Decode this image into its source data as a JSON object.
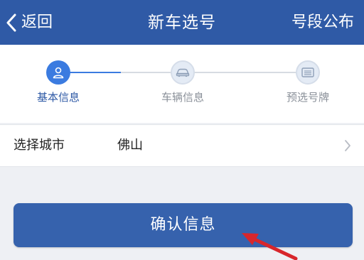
{
  "header": {
    "back_label": "返回",
    "title": "新车选号",
    "right_action": "号段公布",
    "background": "#2f5aa6"
  },
  "steps": {
    "items": [
      {
        "label": "基本信息",
        "icon": "user-icon",
        "active": true
      },
      {
        "label": "车辆信息",
        "icon": "car-icon",
        "active": false
      },
      {
        "label": "预选号牌",
        "icon": "license-plate-icon",
        "active": false
      }
    ],
    "active_color": "#3b7be0",
    "inactive_color": "#8a9099"
  },
  "city": {
    "label": "选择城市",
    "value": "佛山"
  },
  "confirm_button": {
    "label": "确认信息",
    "color": "#3662ad"
  },
  "annotation": {
    "icon": "red-arrow-icon",
    "color": "#d8262b"
  }
}
